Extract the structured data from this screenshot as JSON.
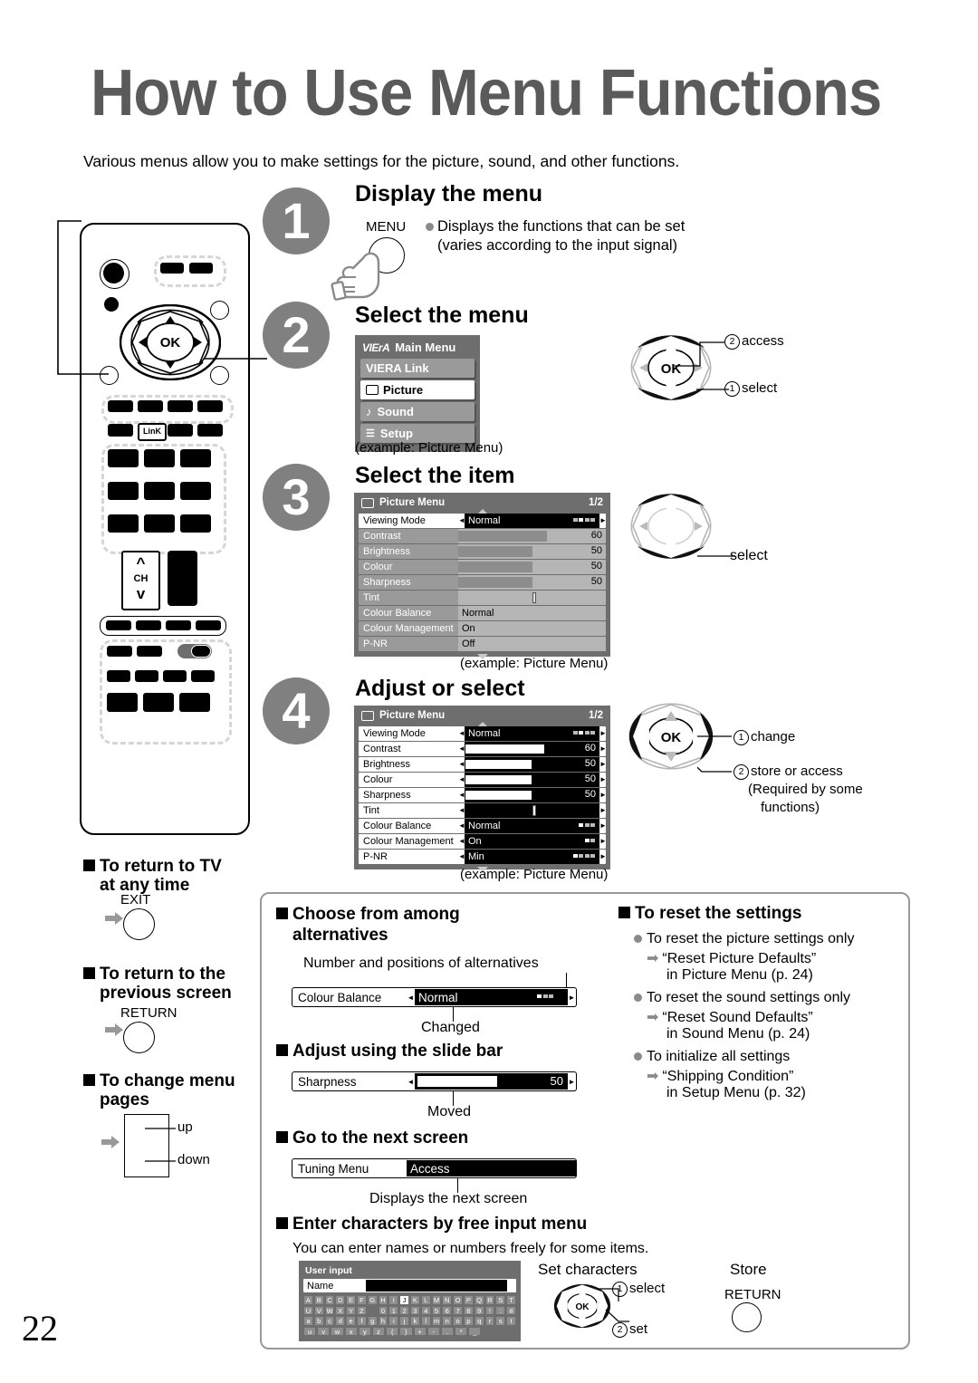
{
  "page": {
    "title": "How to Use Menu Functions",
    "intro": "Various menus allow you to make settings for the picture, sound, and other functions.",
    "number": "22"
  },
  "steps": [
    {
      "num": "1",
      "heading": "Display the menu",
      "button_label": "MENU",
      "bullet": "Displays the functions that can be set",
      "bullet_line2": "(varies according to the input signal)"
    },
    {
      "num": "2",
      "heading": "Select the menu",
      "caption": "(example: Picture Menu)",
      "pad_labels": [
        {
          "num": "2",
          "text": "access"
        },
        {
          "num": "1",
          "text": "select"
        }
      ]
    },
    {
      "num": "3",
      "heading": "Select the item",
      "caption": "(example: Picture Menu)",
      "pad_labels": [
        {
          "num": "",
          "text": "select"
        }
      ]
    },
    {
      "num": "4",
      "heading": "Adjust or select",
      "caption": "(example: Picture Menu)",
      "pad_labels": [
        {
          "num": "1",
          "text": "change"
        },
        {
          "num": "2",
          "text": "store or access"
        }
      ],
      "pad_note_line1": "(Required by some",
      "pad_note_line2": "functions)"
    }
  ],
  "main_menu": {
    "brand": "VIErA",
    "title": "Main Menu",
    "items": [
      {
        "label": "VIERA Link",
        "icon": "",
        "selected": false
      },
      {
        "label": "Picture",
        "icon": "screen-icon",
        "selected": true
      },
      {
        "label": "Sound",
        "icon": "note-icon",
        "selected": false
      },
      {
        "label": "Setup",
        "icon": "list-icon",
        "selected": false
      }
    ]
  },
  "picture_menu_step3": {
    "title": "Picture Menu",
    "page_indicator": "1/2",
    "rows": [
      {
        "name": "Viewing Mode",
        "value": "Normal",
        "type": "option",
        "selected": true,
        "alternatives": 4,
        "alt_active": 2
      },
      {
        "name": "Contrast",
        "value": "60",
        "type": "slider",
        "fill_pct": 60
      },
      {
        "name": "Brightness",
        "value": "50",
        "type": "slider",
        "fill_pct": 50
      },
      {
        "name": "Colour",
        "value": "50",
        "type": "slider",
        "fill_pct": 50
      },
      {
        "name": "Sharpness",
        "value": "50",
        "type": "slider",
        "fill_pct": 50
      },
      {
        "name": "Tint",
        "value": "",
        "type": "tint",
        "fill_pct": 50
      },
      {
        "name": "Colour Balance",
        "value": "Normal",
        "type": "text"
      },
      {
        "name": "Colour Management",
        "value": "On",
        "type": "text"
      },
      {
        "name": "P-NR",
        "value": "Off",
        "type": "text"
      }
    ]
  },
  "picture_menu_step4": {
    "title": "Picture Menu",
    "page_indicator": "1/2",
    "rows": [
      {
        "name": "Viewing Mode",
        "value": "Normal",
        "type": "option",
        "alternatives": 4,
        "alt_active": 2
      },
      {
        "name": "Contrast",
        "value": "60",
        "type": "slider",
        "fill_pct": 60
      },
      {
        "name": "Brightness",
        "value": "50",
        "type": "slider",
        "fill_pct": 50
      },
      {
        "name": "Colour",
        "value": "50",
        "type": "slider",
        "fill_pct": 50
      },
      {
        "name": "Sharpness",
        "value": "50",
        "type": "slider",
        "fill_pct": 50
      },
      {
        "name": "Tint",
        "value": "",
        "type": "tint",
        "fill_pct": 50
      },
      {
        "name": "Colour Balance",
        "value": "Normal",
        "type": "option",
        "alternatives": 3,
        "alt_active": 1
      },
      {
        "name": "Colour Management",
        "value": "On",
        "type": "option",
        "alternatives": 2,
        "alt_active": 1
      },
      {
        "name": "P-NR",
        "value": "Min",
        "type": "option",
        "alternatives": 4,
        "alt_active": 1
      }
    ]
  },
  "side_notes": [
    {
      "heading_line1": "To return to TV",
      "heading_line2": "at any time",
      "button": "EXIT"
    },
    {
      "heading_line1": "To return to the",
      "heading_line2": "previous screen",
      "button": "RETURN"
    },
    {
      "heading_line1": "To change menu",
      "heading_line2": "pages",
      "up_label": "up",
      "down_label": "down"
    }
  ],
  "tips": {
    "alternatives": {
      "heading_line1": "Choose from among",
      "heading_line2": "alternatives",
      "note_top": "Number and positions of alternatives",
      "note_bottom": "Changed",
      "bar": {
        "name": "Colour Balance",
        "value": "Normal",
        "alternatives": 3,
        "alt_active": 1
      }
    },
    "slide_bar": {
      "heading": "Adjust using the slide bar",
      "note_bottom": "Moved",
      "bar": {
        "name": "Sharpness",
        "value": "50",
        "fill_pct": 42
      }
    },
    "next_screen": {
      "heading": "Go to the next screen",
      "note_bottom": "Displays the next screen",
      "bar": {
        "name": "Tuning Menu",
        "value": "Access"
      }
    },
    "free_input": {
      "heading": "Enter characters by free input menu",
      "subtitle": "You can enter names or numbers freely for some items.",
      "osd": {
        "title": "User input",
        "field_label": "Name",
        "keyboard": [
          [
            "A",
            "B",
            "C",
            "D",
            "E",
            "F",
            "G",
            "H",
            "I",
            "J",
            "K",
            "L",
            "M",
            "N",
            "O",
            "P",
            "Q",
            "R",
            "S",
            "T"
          ],
          [
            "U",
            "V",
            "W",
            "X",
            "Y",
            "Z",
            "",
            "0",
            "1",
            "2",
            "3",
            "4",
            "5",
            "6",
            "7",
            "8",
            "9",
            "!",
            ":",
            "#"
          ],
          [
            "a",
            "b",
            "c",
            "d",
            "e",
            "f",
            "g",
            "h",
            "i",
            "j",
            "k",
            "l",
            "m",
            "n",
            "o",
            "p",
            "q",
            "r",
            "s",
            "t"
          ],
          [
            "u",
            "v",
            "w",
            "x",
            "y",
            "z",
            "(",
            ")",
            "+",
            "-",
            ".",
            "*",
            "_",
            "",
            "",
            "",
            "",
            "",
            "",
            ""
          ]
        ],
        "highlight": "J"
      },
      "set_characters": {
        "title": "Set characters",
        "labels": [
          {
            "num": "1",
            "text": "select"
          },
          {
            "num": "2",
            "text": "set"
          }
        ]
      },
      "store": {
        "title": "Store",
        "button": "RETURN"
      }
    },
    "reset": {
      "heading": "To reset the settings",
      "items": [
        {
          "bullet": "To reset the picture settings only",
          "arrow_line1": "“Reset Picture Defaults”",
          "arrow_line2": "in Picture Menu (p. 24)"
        },
        {
          "bullet": "To reset the sound settings only",
          "arrow_line1": "“Reset Sound Defaults”",
          "arrow_line2": "in Sound Menu (p. 24)"
        },
        {
          "bullet": "To initialize all settings",
          "arrow_line1": "“Shipping Condition”",
          "arrow_line2": "in Setup Menu (p. 32)"
        }
      ]
    }
  },
  "remote": {
    "link_button": "LinK",
    "ch_label": "CH"
  },
  "colors": {
    "step_circle": "#808080",
    "osd_bg": "#6e6e6e",
    "osd_row": "#9a9a9a",
    "title_grey": "#5a5a5a"
  }
}
